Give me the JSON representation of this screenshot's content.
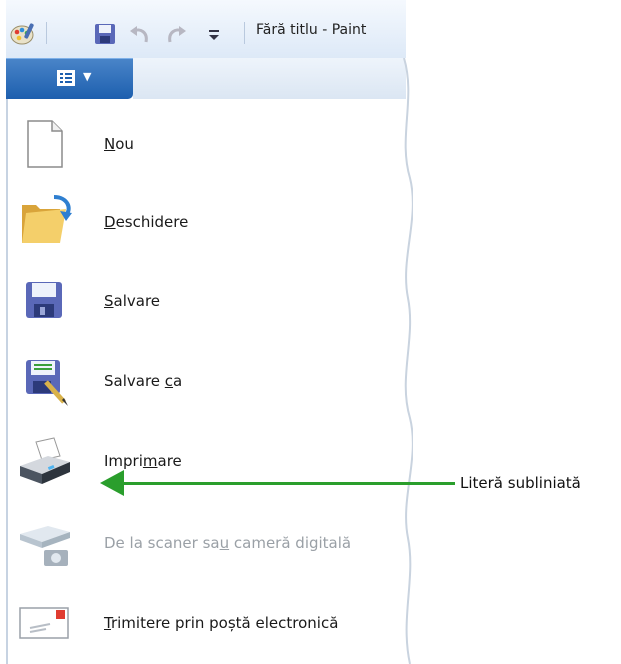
{
  "window": {
    "title": "Fără titlu - Paint",
    "quick_access": [
      "paint-app-icon",
      "save-icon",
      "undo-icon",
      "redo-icon",
      "customize-dropdown-icon"
    ]
  },
  "app_menu_button": {
    "icon": "menu-list-icon"
  },
  "menu": {
    "items": [
      {
        "pre": "",
        "u": "N",
        "post": "ou",
        "icon": "blank-document-icon",
        "enabled": true
      },
      {
        "pre": "",
        "u": "D",
        "post": "eschidere",
        "icon": "open-folder-icon",
        "enabled": true
      },
      {
        "pre": "",
        "u": "S",
        "post": "alvare",
        "icon": "floppy-disk-icon",
        "enabled": true
      },
      {
        "pre": "Salvare ",
        "u": "c",
        "post": "a",
        "icon": "save-as-icon",
        "enabled": true
      },
      {
        "pre": "Impri",
        "u": "m",
        "post": "are",
        "icon": "printer-icon",
        "enabled": true
      },
      {
        "pre": "De la scaner sa",
        "u": "u",
        "post": " cameră digitală",
        "icon": "scanner-camera-icon",
        "enabled": false
      },
      {
        "pre": "",
        "u": "T",
        "post": "rimitere prin poștă electronică",
        "icon": "email-envelope-icon",
        "enabled": true
      }
    ]
  },
  "annotation": {
    "label": "Literă subliniată",
    "color": "#2a9e2c"
  }
}
